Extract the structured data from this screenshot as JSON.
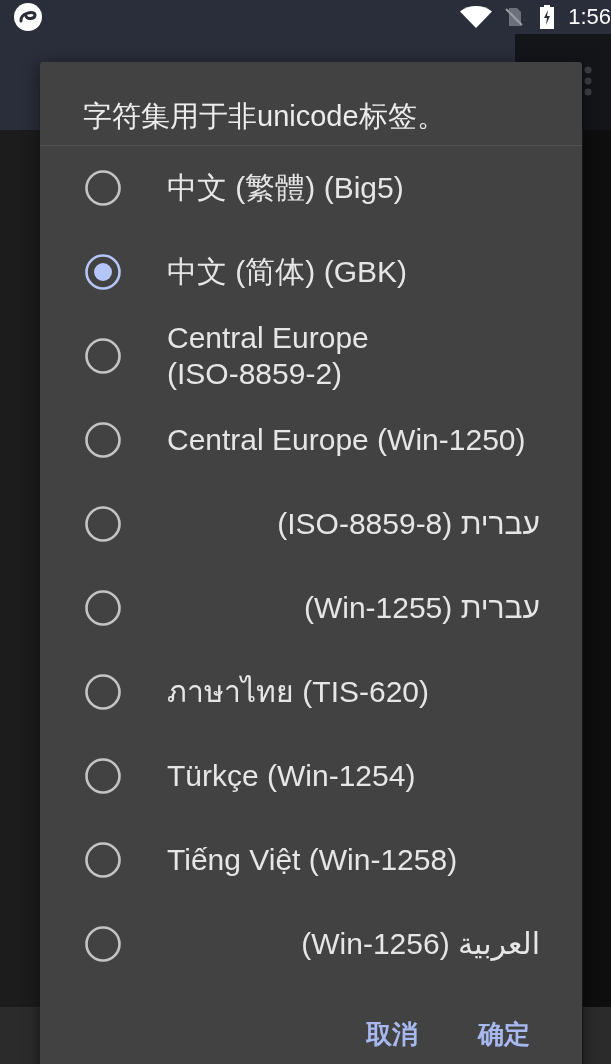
{
  "status_bar": {
    "time": "1:56"
  },
  "dialog": {
    "title": "字符集用于非unicode标签。",
    "options": [
      {
        "label": "中文 (繁體) (Big5)",
        "selected": false
      },
      {
        "label": "中文 (简体) (GBK)",
        "selected": true
      },
      {
        "label": "Central Europe (ISO-8859-2)",
        "selected": false
      },
      {
        "label": "Central Europe (Win-1250)",
        "selected": false
      },
      {
        "label": "עברית (ISO-8859-8)",
        "selected": false
      },
      {
        "label": "עברית (Win-1255)",
        "selected": false
      },
      {
        "label": "ภาษาไทย (TIS-620)",
        "selected": false
      },
      {
        "label": "Türkçe (Win-1254)",
        "selected": false
      },
      {
        "label": "Tiếng Việt (Win-1258)",
        "selected": false
      },
      {
        "label": "العربية (Win-1256)",
        "selected": false
      }
    ],
    "buttons": [
      "取消",
      "确定"
    ]
  }
}
